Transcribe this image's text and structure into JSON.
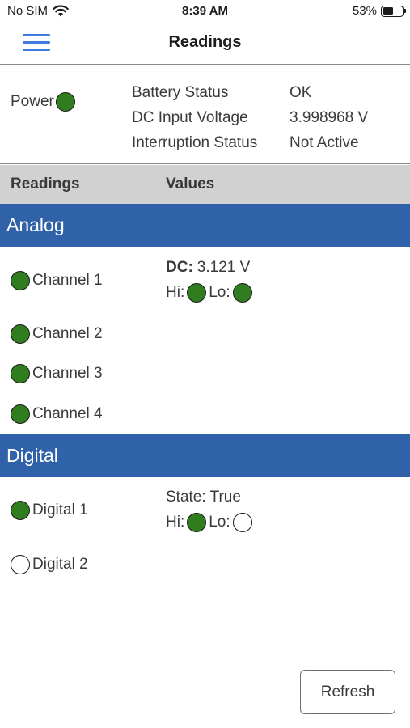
{
  "status_bar": {
    "carrier": "No SIM",
    "time": "8:39 AM",
    "battery_percent": "53%",
    "battery_level": 0.53
  },
  "nav": {
    "title": "Readings",
    "menu_icon": "hamburger-menu-icon",
    "accent_color": "#3d7be0"
  },
  "device_status": {
    "power_label": "Power",
    "power_on": true,
    "rows": [
      {
        "label": "Battery Status",
        "value": "OK"
      },
      {
        "label": "DC Input Voltage",
        "value": "3.998968 V"
      },
      {
        "label": "Interruption Status",
        "value": "Not Active"
      }
    ]
  },
  "table_header": {
    "col1": "Readings",
    "col2": "Values"
  },
  "analog": {
    "title": "Analog",
    "channels": [
      {
        "label": "Channel 1",
        "on": true
      },
      {
        "label": "Channel 2",
        "on": true
      },
      {
        "label": "Channel 3",
        "on": true
      },
      {
        "label": "Channel 4",
        "on": true
      }
    ],
    "reading": {
      "dc_label": "DC:",
      "dc_value": "3.121 V",
      "hi_label": "Hi:",
      "hi_on": true,
      "lo_label": "Lo:",
      "lo_on": true
    }
  },
  "digital": {
    "title": "Digital",
    "channels": [
      {
        "label": "Digital 1",
        "on": true
      },
      {
        "label": "Digital 2",
        "on": false
      }
    ],
    "reading": {
      "state": "State: True",
      "hi_label": "Hi:",
      "hi_on": true,
      "lo_label": "Lo:",
      "lo_on": false
    }
  },
  "actions": {
    "refresh_label": "Refresh"
  },
  "colors": {
    "section_header": "#2f62a8",
    "indicator_on": "#2f7d1f",
    "table_header_bg": "#d1d1d1"
  }
}
